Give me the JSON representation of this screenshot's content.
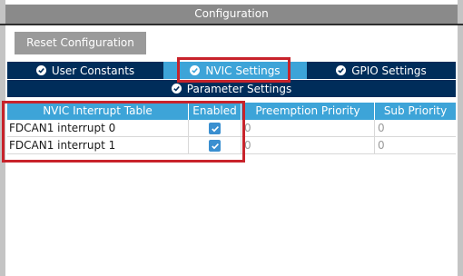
{
  "window": {
    "title": "Configuration"
  },
  "toolbar": {
    "reset_label": "Reset Configuration"
  },
  "tabs": [
    {
      "label": "User Constants",
      "icon": "check-circle-icon",
      "active": false
    },
    {
      "label": "NVIC Settings",
      "icon": "check-circle-icon",
      "active": true
    },
    {
      "label": "GPIO Settings",
      "icon": "check-circle-icon",
      "active": false
    },
    {
      "label": "Parameter Settings",
      "icon": "check-circle-icon",
      "active": false
    }
  ],
  "table": {
    "columns": [
      "NVIC Interrupt Table",
      "Enabled",
      "Preemption Priority",
      "Sub Priority"
    ],
    "rows": [
      {
        "name": "FDCAN1 interrupt 0",
        "enabled": true,
        "preemption": "0",
        "sub": "0"
      },
      {
        "name": "FDCAN1 interrupt 1",
        "enabled": true,
        "preemption": "0",
        "sub": "0"
      }
    ]
  },
  "colors": {
    "tab_bg": "#002d5a",
    "tab_active_bg": "#3da4d8",
    "header_bg": "#3da4d8",
    "highlight": "#c8232b",
    "checkbox": "#3a8fd0",
    "title_bar": "#8a8a8a"
  }
}
